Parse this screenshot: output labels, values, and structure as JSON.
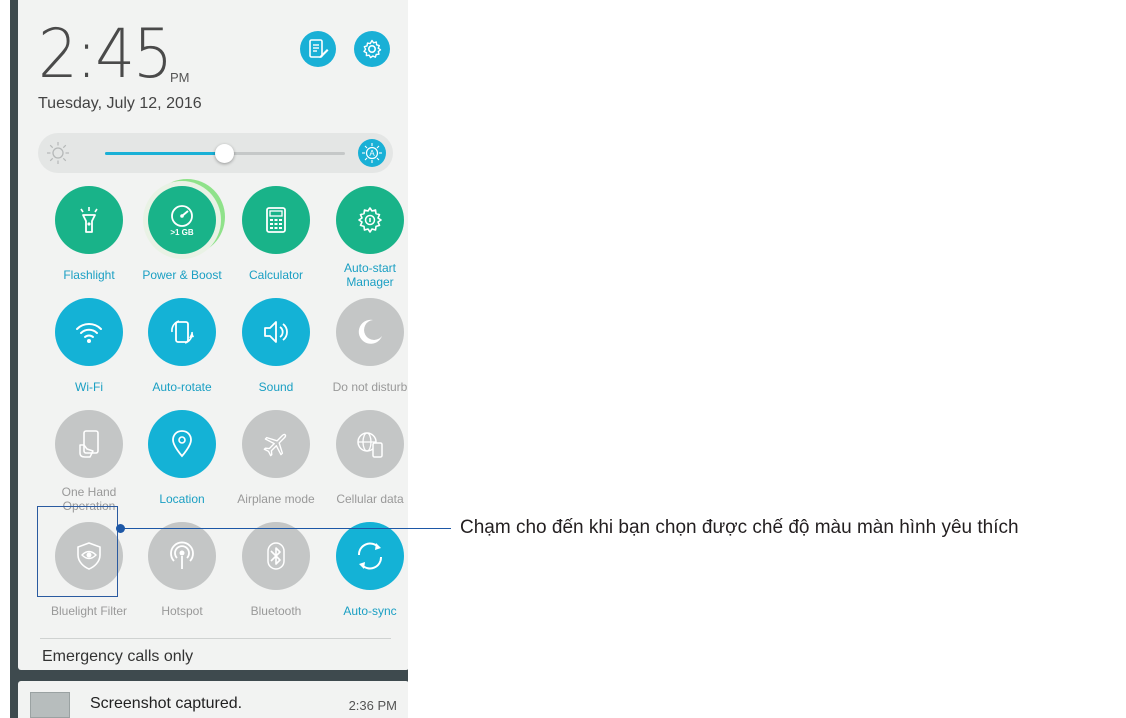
{
  "clock": {
    "time": "2:45",
    "ampm": "PM",
    "date": "Tuesday, July 12, 2016"
  },
  "top_buttons": [
    {
      "name": "edit-note-button",
      "icon": "edit-note-icon"
    },
    {
      "name": "settings-button",
      "icon": "gear-icon"
    }
  ],
  "brightness": {
    "level": 0.5,
    "low_icon": "sun-outline-icon",
    "auto_icon": "auto-brightness-icon"
  },
  "tiles": [
    {
      "label": "Flashlight",
      "icon": "flashlight-icon",
      "state": "green"
    },
    {
      "label": "Power & Boost",
      "icon": "speedometer-icon",
      "state": "green",
      "sublabel": ">1 GB"
    },
    {
      "label": "Calculator",
      "icon": "calculator-icon",
      "state": "green"
    },
    {
      "label": "Auto-start\nManager",
      "icon": "gear-badge-icon",
      "state": "green"
    },
    {
      "label": "Wi-Fi",
      "icon": "wifi-icon",
      "state": "on"
    },
    {
      "label": "Auto-rotate",
      "icon": "auto-rotate-icon",
      "state": "on"
    },
    {
      "label": "Sound",
      "icon": "speaker-icon",
      "state": "on"
    },
    {
      "label": "Do not disturb",
      "icon": "moon-icon",
      "state": "off"
    },
    {
      "label": "One Hand\nOperation",
      "icon": "one-hand-icon",
      "state": "off"
    },
    {
      "label": "Location",
      "icon": "location-pin-icon",
      "state": "on"
    },
    {
      "label": "Airplane mode",
      "icon": "airplane-icon",
      "state": "off"
    },
    {
      "label": "Cellular data",
      "icon": "cellular-globe-icon",
      "state": "off"
    },
    {
      "label": "Bluelight Filter",
      "icon": "eye-shield-icon",
      "state": "off"
    },
    {
      "label": "Hotspot",
      "icon": "hotspot-icon",
      "state": "off"
    },
    {
      "label": "Bluetooth",
      "icon": "bluetooth-icon",
      "state": "off"
    },
    {
      "label": "Auto-sync",
      "icon": "sync-icon",
      "state": "on"
    }
  ],
  "status": {
    "emergency": "Emergency calls only"
  },
  "notification": {
    "title": "Screenshot captured.",
    "time": "2:36 PM",
    "icon": "screenshot-thumbnail"
  },
  "callout": {
    "text": "Chạm cho đến khi bạn chọn được chế độ màu màn hình yêu thích"
  },
  "colors": {
    "accent": "#14b2d6",
    "green": "#19b389",
    "off": "#c4c6c6",
    "callout": "#1d57a6"
  }
}
